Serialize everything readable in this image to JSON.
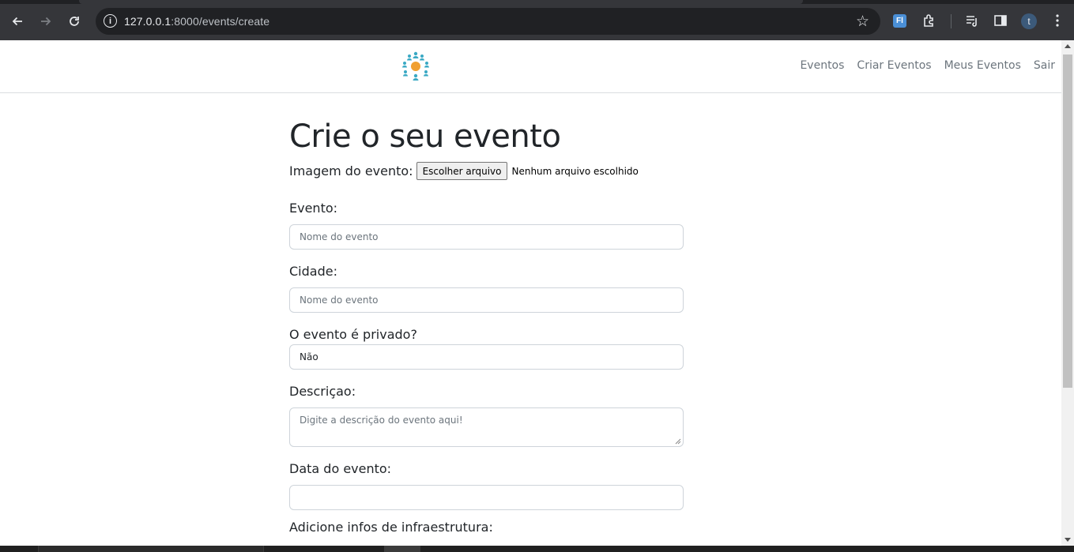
{
  "browser": {
    "url_host": "127.0.0.1",
    "url_rest": ":8000/events/create",
    "profile_initial": "t",
    "extension_label": "Fl"
  },
  "nav": {
    "links": [
      "Eventos",
      "Criar Eventos",
      "Meus Eventos",
      "Sair"
    ]
  },
  "form": {
    "title": "Crie o seu evento",
    "image_label": "Imagem do evento:",
    "file_button": "Escolher arquivo",
    "file_status": "Nenhum arquivo escolhido",
    "event_label": "Evento:",
    "event_placeholder": "Nome do evento",
    "city_label": "Cidade:",
    "city_placeholder": "Nome do evento",
    "private_label": "O evento é privado?",
    "private_value": "Não",
    "description_label": "Descriçao:",
    "description_placeholder": "Digite a descrição do evento aqui!",
    "date_label": "Data do evento:",
    "infra_label": "Adicione infos de infraestrutura:"
  },
  "colors": {
    "logo_center": "#f0a030",
    "logo_people": "#3aa9c4"
  }
}
